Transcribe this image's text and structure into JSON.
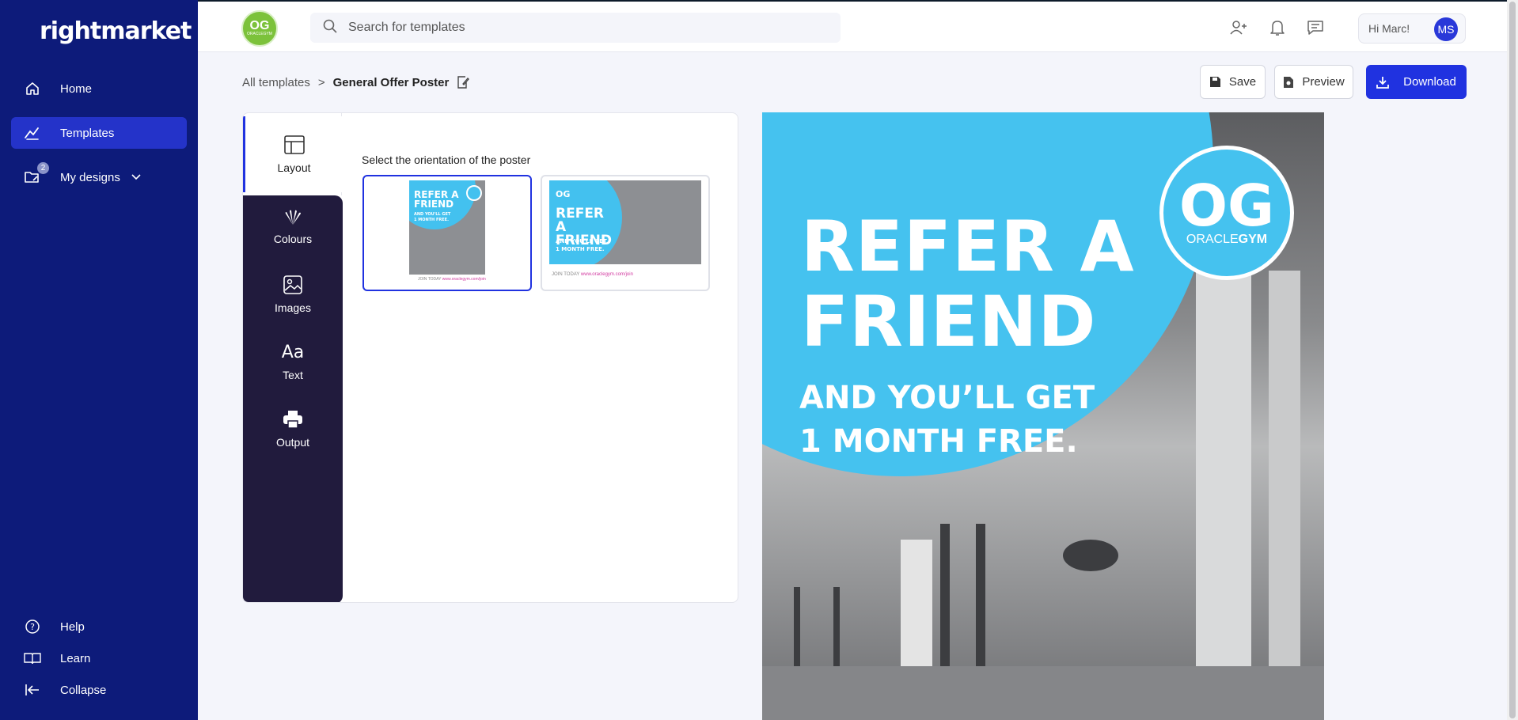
{
  "sidebar": {
    "logo": "rightmarket",
    "nav": [
      {
        "label": "Home",
        "icon": "home-icon"
      },
      {
        "label": "Templates",
        "icon": "templates-icon",
        "active": true
      },
      {
        "label": "My designs",
        "icon": "folder-edit-icon",
        "badge": "2"
      }
    ],
    "footer": [
      {
        "label": "Help",
        "icon": "help-icon"
      },
      {
        "label": "Learn",
        "icon": "book-icon"
      },
      {
        "label": "Collapse",
        "icon": "collapse-icon"
      }
    ]
  },
  "header": {
    "brand": {
      "og": "OG",
      "name": "ORACLEGYM"
    },
    "search": {
      "placeholder": "Search for templates",
      "value": ""
    },
    "greeting": "Hi Marc!",
    "avatar_initials": "MS"
  },
  "breadcrumb": {
    "root": "All templates",
    "separator": ">",
    "current": "General Offer Poster"
  },
  "actions": {
    "save": "Save",
    "preview": "Preview",
    "download": "Download"
  },
  "tools": [
    {
      "label": "Layout",
      "icon": "layout-icon",
      "active": true
    },
    {
      "label": "Colours",
      "icon": "palette-icon"
    },
    {
      "label": "Images",
      "icon": "image-icon"
    },
    {
      "label": "Text",
      "icon": "text-icon",
      "glyph": "Aa"
    },
    {
      "label": "Output",
      "icon": "printer-icon"
    }
  ],
  "layout_panel": {
    "title": "Select the orientation of the poster",
    "options": [
      {
        "name": "Portrait",
        "selected": true,
        "headline": "REFER A FRIEND",
        "sub1": "AND YOU'LL GET",
        "sub2": "1 MONTH FREE.",
        "join": "JOIN TODAY",
        "url": "www.oraclegym.com/join"
      },
      {
        "name": "Landscape",
        "selected": false,
        "headline": "REFER A FRIEND",
        "sub1": "AND YOU'LL GET",
        "sub2": "1 MONTH FREE.",
        "join": "JOIN TODAY",
        "url": "www.oraclegym.com/join"
      }
    ]
  },
  "poster": {
    "line1": "REFER A",
    "line2": "FRIEND",
    "line3": "AND YOU’LL GET",
    "line4": "1 MONTH FREE.",
    "badge_og": "OG",
    "badge_oracle": "ORACLE",
    "badge_gym": "GYM"
  },
  "colors": {
    "sidebar": "#0d1b7a",
    "accent": "#2032e0",
    "poster_blue": "#45c2ef",
    "tool_rail": "#211b3d",
    "brand_green": "#7cc23b"
  }
}
